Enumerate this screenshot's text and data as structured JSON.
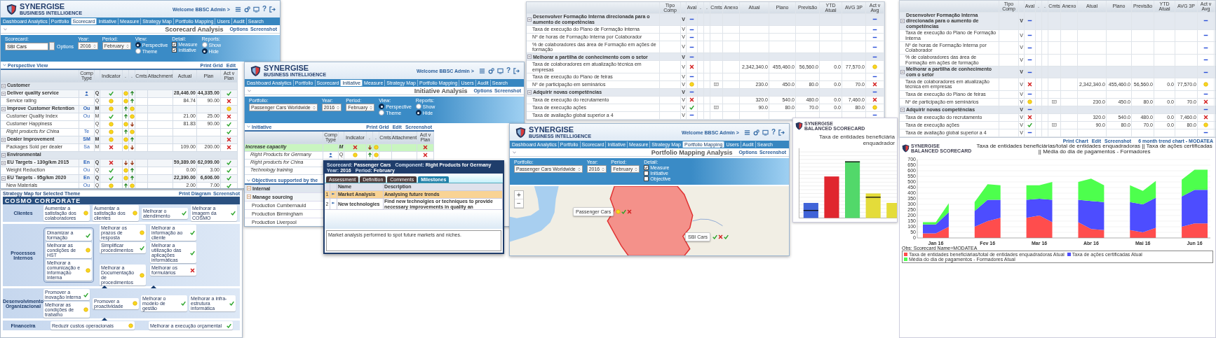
{
  "windows": [
    {
      "kind": "scorecard",
      "logo": {
        "name": "SYNERGISE",
        "tagline": "BUSINESS INTELLIGENCE"
      },
      "welcome": "Welcome BBSC Admin >",
      "help": "?",
      "nav": [
        {
          "label": "Dashboard Analytics",
          "selected": false
        },
        {
          "label": "Portfolio",
          "selected": false
        },
        {
          "label": "Scorecard",
          "selected": true
        },
        {
          "label": "Initiative",
          "selected": false
        },
        {
          "label": "Measure",
          "selected": false
        },
        {
          "label": "Strategy Map",
          "selected": false
        },
        {
          "label": "Portfolio Mapping",
          "selected": false
        },
        {
          "label": "Users",
          "selected": false
        },
        {
          "label": "Audit",
          "selected": false
        },
        {
          "label": "Search",
          "selected": false
        }
      ],
      "page_title": "Scorecard Analysis",
      "options": [
        "Options",
        "Screenshot"
      ],
      "filters": [
        {
          "kind": "field",
          "label": "Scorecard:",
          "value": "SBI Cars",
          "suffix": "Options"
        },
        {
          "kind": "select",
          "label": "Year:",
          "value": "2016"
        },
        {
          "kind": "select",
          "label": "Period:",
          "value": "February"
        },
        {
          "kind": "radio",
          "label": "View:",
          "options": [
            {
              "label": "Perspective",
              "selected": true
            },
            {
              "label": "Theme",
              "selected": false
            }
          ]
        },
        {
          "kind": "check",
          "label": "Detail:",
          "options": [
            {
              "label": "Measure",
              "checked": true
            },
            {
              "label": "Initiative",
              "checked": true
            }
          ]
        },
        {
          "kind": "radio",
          "label": "Reports:",
          "options": [
            {
              "label": "Show",
              "selected": false
            },
            {
              "label": "Hide",
              "selected": true
            }
          ]
        }
      ],
      "section": "Perspective View",
      "links": [
        "Print Grid",
        "Edit"
      ],
      "columns": [
        "Comp Type",
        "Indicator",
        ".",
        ".",
        "Cmts",
        "Attachment",
        "Actual",
        "Plan",
        "Act v Plan"
      ],
      "rows": [
        {
          "kind": "group",
          "name": "Customer",
          "expanded": true
        },
        {
          "kind": "objective",
          "name": "Deliver quality service",
          "expanded": true,
          "comp_icon": true,
          "type": "Q",
          "indicator": {
            "kind": "check"
          },
          "trend_a": {
            "kind": "dot"
          },
          "trend_b": {
            "kind": "arrow_up"
          },
          "actual": "28,446.00",
          "plan": "44,335.00",
          "vs_plan": {
            "kind": "check"
          }
        },
        {
          "kind": "measure",
          "name": "Service rating",
          "type": "Q",
          "indicator": {
            "kind": "dot"
          },
          "trend_a": {
            "kind": "dot"
          },
          "trend_b": {
            "kind": "arrow_up"
          },
          "actual": "84.74",
          "plan": "90.00",
          "vs_plan": {
            "kind": "cross"
          }
        },
        {
          "kind": "objective",
          "name": "Improve Customer Retention",
          "expanded": true,
          "comp": "Ou",
          "type": "M",
          "indicator": {
            "kind": "dot"
          },
          "trend_a": {
            "kind": "arrow_up"
          },
          "trend_b": {
            "kind": "dot"
          },
          "vs_plan": {
            "kind": "dot"
          }
        },
        {
          "kind": "measure",
          "name": "Customer Quality Index",
          "comp": "Ou",
          "type": "M",
          "indicator": {
            "kind": "check"
          },
          "trend_a": {
            "kind": "arrow_up"
          },
          "trend_b": {
            "kind": "dot"
          },
          "actual": "21.00",
          "plan": "25.00",
          "vs_plan": {
            "kind": "cross"
          }
        },
        {
          "kind": "measure",
          "name": "Customer Happiness",
          "type": "Q",
          "indicator": {
            "kind": "dot"
          },
          "trend_a": {
            "kind": "dot"
          },
          "trend_b": {
            "kind": "arrow_down"
          },
          "actual": "81.83",
          "plan": "90.00",
          "vs_plan": {
            "kind": "check"
          }
        },
        {
          "kind": "initiative",
          "name": "Right products for China",
          "comp": "Te",
          "type": "Q",
          "indicator": {
            "kind": "dot"
          },
          "trend_a": {
            "kind": "arrow_up"
          },
          "trend_b": {
            "kind": "dot"
          },
          "vs_plan": {
            "kind": "check"
          }
        },
        {
          "kind": "objective",
          "name": "Dealer Improvement",
          "expanded": true,
          "comp": "SM",
          "type": "M",
          "indicator": {
            "kind": "dot"
          },
          "trend_a": {
            "kind": "dot"
          },
          "trend_b": {
            "kind": "arrow_up"
          },
          "vs_plan": {
            "kind": "cross"
          }
        },
        {
          "kind": "measure",
          "name": "Packages Sold per dealer",
          "comp": "Sa",
          "type": "M",
          "indicator": {
            "kind": "cross"
          },
          "trend_a": {
            "kind": "dot"
          },
          "trend_b": {
            "kind": "arrow_down"
          },
          "actual": "109.00",
          "plan": "200.00",
          "vs_plan": {
            "kind": "cross"
          }
        },
        {
          "kind": "group",
          "name": "Environmental",
          "expanded": true
        },
        {
          "kind": "objective",
          "name": "EU Targets - 130g/km 2015",
          "expanded": true,
          "comp": "En",
          "type": "Q",
          "indicator": {
            "kind": "cross"
          },
          "trend_a": {
            "kind": "arrow_down"
          },
          "trend_b": {
            "kind": "arrow_down"
          },
          "actual": "59,389.00",
          "plan": "62,099.00",
          "vs_plan": {
            "kind": "check"
          }
        },
        {
          "kind": "measure",
          "name": "Weight Reduction",
          "comp": "Ou",
          "type": "Q",
          "indicator": {
            "kind": "check"
          },
          "trend_a": {
            "kind": "dot"
          },
          "trend_b": {
            "kind": "arrow_up"
          },
          "actual": "0.00",
          "plan": "3.00",
          "vs_plan": {
            "kind": "check"
          }
        },
        {
          "kind": "objective",
          "name": "EU Targets - 95g/km 2020",
          "expanded": true,
          "comp": "En",
          "type": "Q",
          "indicator": {
            "kind": "check"
          },
          "trend_a": {
            "kind": "dot"
          },
          "trend_b": {
            "kind": "arrow_up"
          },
          "actual": "22,390.00",
          "plan": "6,606.00",
          "vs_plan": {
            "kind": "check"
          }
        },
        {
          "kind": "measure",
          "name": "New Materials",
          "comp": "Ou",
          "type": "Q",
          "indicator": {
            "kind": "dot"
          },
          "trend_a": {
            "kind": "arrow_up"
          },
          "trend_b": {
            "kind": "dot"
          },
          "actual": "2.00",
          "plan": "7.00",
          "vs_plan": {
            "kind": "check"
          }
        }
      ]
    },
    {
      "kind": "initiative",
      "logo": {
        "name": "SYNERGISE",
        "tagline": "BUSINESS INTELLIGENCE"
      },
      "welcome": "Welcome BBSC Admin >",
      "help": "?",
      "nav": [
        {
          "label": "Dashboard Analytics",
          "selected": false
        },
        {
          "label": "Portfolio",
          "selected": false
        },
        {
          "label": "Scorecard",
          "selected": false
        },
        {
          "label": "Initiative",
          "selected": true
        },
        {
          "label": "Measure",
          "selected": false
        },
        {
          "label": "Strategy Map",
          "selected": false
        },
        {
          "label": "Portfolio Mapping",
          "selected": false
        },
        {
          "label": "Users",
          "selected": false
        },
        {
          "label": "Audit",
          "selected": false
        },
        {
          "label": "Search",
          "selected": false
        }
      ],
      "page_title": "Initiative Analysis",
      "options": [
        "Options",
        "Screenshot"
      ],
      "filters": [
        {
          "kind": "select",
          "label": "Portfolio:",
          "value": "Passenger Cars Worldwide"
        },
        {
          "kind": "select",
          "label": "Year:",
          "value": "2016"
        },
        {
          "kind": "select",
          "label": "Period:",
          "value": "February"
        },
        {
          "kind": "radio",
          "label": "View:",
          "options": [
            {
              "label": "Perspective",
              "selected": true
            },
            {
              "label": "Theme",
              "selected": false
            }
          ]
        },
        {
          "kind": "radio",
          "label": "Reports:",
          "options": [
            {
              "label": "Show",
              "selected": false
            },
            {
              "label": "Hide",
              "selected": true
            }
          ]
        }
      ],
      "section": "Initiative",
      "links": [
        "Print Grid",
        "Edit",
        "Screenshot"
      ],
      "columns": [
        "Comp Type",
        "Indicator",
        ".",
        ".",
        "Cmts",
        "Attachment",
        "Act v Plan"
      ],
      "rows": [
        {
          "kind": "objective",
          "name": "Increase capacity",
          "selected": true,
          "type": "M",
          "indicator": {
            "kind": "cross"
          },
          "trend_a": {
            "kind": "arrow_down"
          },
          "trend_b": {
            "kind": "dot"
          },
          "vs_plan": {
            "kind": "cross"
          }
        },
        {
          "kind": "initiative",
          "name": "Right Products for Germany",
          "selected": false,
          "comp_icon": true,
          "type": "Q",
          "indicator": {
            "kind": "dot"
          },
          "trend_a": {
            "kind": "arrow_up"
          },
          "trend_b": {
            "kind": "dot"
          },
          "vs_plan": {
            "kind": "cross"
          }
        },
        {
          "kind": "initiative",
          "name": "Right products for China",
          "selected": false
        },
        {
          "kind": "initiative",
          "name": "Technology training",
          "selected": false
        }
      ],
      "section2": "Objectives supported by the",
      "rows2": [
        {
          "kind": "group",
          "name": "Internal",
          "expanded": true
        },
        {
          "kind": "objective",
          "name": "Manage sourcing",
          "expanded": true
        },
        {
          "kind": "measure",
          "name": "Production Cumbernauld"
        },
        {
          "kind": "measure",
          "name": "Production Birmingham"
        },
        {
          "kind": "measure",
          "name": "Production Liverpool"
        }
      ]
    },
    {
      "kind": "mapping",
      "logo": {
        "name": "SYNERGISE",
        "tagline": "BUSINESS INTELLIGENCE"
      },
      "welcome": "Welcome BBSC Admin >",
      "help": "?",
      "nav": [
        {
          "label": "Dashboard Analytics",
          "selected": false
        },
        {
          "label": "Portfolio",
          "selected": false
        },
        {
          "label": "Scorecard",
          "selected": false
        },
        {
          "label": "Initiative",
          "selected": false
        },
        {
          "label": "Measure",
          "selected": false
        },
        {
          "label": "Strategy Map",
          "selected": false
        },
        {
          "label": "Portfolio Mapping",
          "selected": true
        },
        {
          "label": "Users",
          "selected": false
        },
        {
          "label": "Audit",
          "selected": false
        },
        {
          "label": "Search",
          "selected": false
        }
      ],
      "page_title": "Portfolio Mapping Analysis",
      "options": [
        "Options",
        "Screenshot"
      ],
      "filters": [
        {
          "kind": "select",
          "label": "Portfolio:",
          "value": "Passenger Cars Worldwide"
        },
        {
          "kind": "select",
          "label": "Year:",
          "value": "2016"
        },
        {
          "kind": "select",
          "label": "Period:",
          "value": "February"
        },
        {
          "kind": "check",
          "label": "Detail:",
          "options": [
            {
              "label": "Measure",
              "checked": true
            },
            {
              "label": "Initiative",
              "checked": false
            },
            {
              "label": "Objective",
              "checked": false
            }
          ]
        }
      ],
      "map": {
        "zoom": [
          "+",
          "−"
        ],
        "markers": [
          {
            "label": "Passenger Cars",
            "statuses": [
              {
                "kind": "dot"
              },
              {
                "kind": "check"
              },
              {
                "kind": "cross"
              }
            ]
          },
          {
            "label": "SBI Cars",
            "statuses": [
              {
                "kind": "check"
              },
              {
                "kind": "cross"
              },
              {
                "kind": "check"
              }
            ]
          }
        ]
      }
    }
  ],
  "popup": {
    "fields": [
      {
        "label": "Scorecard:",
        "value": "Passenger Cars"
      },
      {
        "label": "Component:",
        "value": "Right Products for Germany"
      },
      {
        "label": "Year:",
        "value": "2016"
      },
      {
        "label": "Period:",
        "value": "February"
      }
    ],
    "tabs": [
      {
        "label": "Assessment",
        "selected": false
      },
      {
        "label": "Definition",
        "selected": false
      },
      {
        "label": "Comments",
        "selected": false
      },
      {
        "label": "Milestones",
        "selected": true
      }
    ],
    "columns": [
      "Name",
      "Description"
    ],
    "rows": [
      {
        "index": "1",
        "name": "Market Analysis",
        "description": "Analysing future trends",
        "selected": true
      },
      {
        "index": "2",
        "name": "New technologies",
        "description": "Find new technolgies or techniques to provide necessary improvements in quality an",
        "selected": false
      }
    ],
    "notes": "Market analysis performed to spot future markets and niches."
  },
  "p5": {
    "table": {
      "columns": [
        "Tipo Comp",
        "Aval",
        ".",
        ".",
        "Cmts",
        "Anexo",
        "Atual",
        "Plano",
        "Previsão",
        "YTD Atual",
        "AVG 3P",
        "Act v Avg"
      ],
      "rows": [
        {
          "kind": "group",
          "name": "Desenvolver Formação Interna direcionada para o aumento de competências",
          "expanded": true,
          "type": "V",
          "aval": {
            "kind": "dash"
          },
          "act": {
            "kind": "dash"
          }
        },
        {
          "kind": "measure",
          "name": "Taxa de execução do Plano de Formação Interna",
          "type": "V",
          "aval": {
            "kind": "dash"
          },
          "act": {
            "kind": "dash"
          }
        },
        {
          "kind": "measure",
          "name": "Nº de horas de Formação Interna por Colaborador",
          "type": "V",
          "aval": {
            "kind": "dash"
          },
          "act": {
            "kind": "dash"
          }
        },
        {
          "kind": "measure",
          "name": "% de colaboradores das área de Formação em ações de formação",
          "type": "V",
          "aval": {
            "kind": "dash"
          },
          "act": {
            "kind": "dash"
          }
        },
        {
          "kind": "group",
          "name": "Melhorar a partilha de conhecimento com o setor",
          "expanded": true,
          "type": "V",
          "aval": {
            "kind": "dash"
          },
          "act": {
            "kind": "dash"
          }
        },
        {
          "kind": "measure",
          "name": "Taxa de colaboradores em atualização técnica em empresas",
          "type": "V",
          "aval": {
            "kind": "cross"
          },
          "atual": "2,342,340.0",
          "plano": "455,460.0",
          "previsao": "56,560.0",
          "ytd": "0.0",
          "avg": "77,570.0",
          "act": {
            "kind": "dot"
          }
        },
        {
          "kind": "measure",
          "name": "Taxa de execução do Plano de feiras",
          "type": "V",
          "aval": {
            "kind": "dash"
          },
          "act": {
            "kind": "dash"
          }
        },
        {
          "kind": "measure",
          "name": "Nº de participação em seminários",
          "type": "V",
          "aval": {
            "kind": "dot"
          },
          "comment": true,
          "atual": "230.0",
          "plano": "450.0",
          "previsao": "80.0",
          "ytd": "0.0",
          "avg": "70.0",
          "act": {
            "kind": "cross"
          }
        },
        {
          "kind": "group",
          "name": "Adquirir novas competências",
          "expanded": true,
          "type": "V",
          "aval": {
            "kind": "dash"
          },
          "act": {
            "kind": "dash"
          }
        },
        {
          "kind": "measure",
          "name": "Taxa de execução do recrutamento",
          "type": "V",
          "aval": {
            "kind": "cross"
          },
          "atual": "320.0",
          "plano": "540.0",
          "previsao": "480.0",
          "ytd": "0.0",
          "avg": "7,460.0",
          "act": {
            "kind": "cross"
          }
        },
        {
          "kind": "measure",
          "name": "Taxa de execução ações",
          "type": "V",
          "aval": {
            "kind": "check"
          },
          "comment": true,
          "atual": "90.0",
          "plano": "80.0",
          "previsao": "70.0",
          "ytd": "0.0",
          "avg": "80.0",
          "act": {
            "kind": "dot"
          }
        },
        {
          "kind": "measure",
          "name": "Taxa de avaliação global superior a 4",
          "type": "V",
          "aval": {
            "kind": "dash"
          },
          "act": {
            "kind": "dash"
          }
        }
      ]
    },
    "chart": {
      "logo": {
        "name": "SYNERGISE",
        "tagline": "BALANCED SCORECARD"
      },
      "title_lines": [
        "Taxa de entidades beneficiária",
        "enquadrador"
      ]
    }
  },
  "strategy": {
    "header": "Strategy Map for Selected Theme",
    "links": [
      "Print Diagram",
      "Screenshot"
    ],
    "title": "COSMO CORPORATE",
    "lanes": [
      {
        "name": "Clientes",
        "nodes": [
          {
            "label": "Aumentar a satisfação dos colaboradores",
            "status": {
              "kind": "dot"
            }
          },
          {
            "label": "Aumentar a satisfação dos clientes",
            "status": {
              "kind": "dot"
            }
          },
          {
            "label": "Melhorar o atendimento",
            "status": {
              "kind": "check"
            }
          },
          {
            "label": "Melhorar a imagem da COSMO",
            "status": {
              "kind": "check"
            }
          }
        ]
      },
      {
        "name": "Processos Internos",
        "group": [
          {
            "label": "Dinamizar a formação",
            "status": {
              "kind": "check"
            }
          },
          {
            "label": "Melhorar as condições de HST",
            "status": {
              "kind": "dot"
            }
          },
          {
            "label": "Melhorar a comunicação e informação interna",
            "status": {
              "kind": "dot"
            }
          }
        ],
        "nodes": [
          {
            "label": "Melhorar os prazos de resposta",
            "status": {
              "kind": "dot"
            }
          },
          {
            "label": "Melhorar a informação ao cliente",
            "status": {
              "kind": "check"
            }
          },
          {
            "label": "Simplificar procedimentos",
            "status": {
              "kind": "check"
            }
          },
          {
            "label": "Melhorar a utilização das aplicações informáticas",
            "status": {
              "kind": "check"
            }
          },
          {
            "label": "Melhorar a Documentação de procedimentos",
            "status": {
              "kind": "dot"
            }
          },
          {
            "label": "Melhorar os formulários",
            "status": {
              "kind": "cross"
            }
          }
        ]
      },
      {
        "name": "Desenvolvimento Organizacional",
        "stack": [
          {
            "label": "Promover a inovação interna",
            "status": {
              "kind": "check"
            }
          },
          {
            "label": "Melhorar as condições de trabalho",
            "status": {
              "kind": "dot"
            }
          }
        ],
        "nodes": [
          {
            "label": "Promover a proactividade",
            "status": {
              "kind": "dot"
            }
          },
          {
            "label": "Melhorar o modelo de gestão",
            "status": {
              "kind": "check"
            }
          },
          {
            "label": "Melhorar a infra-estrutura informática",
            "status": {
              "kind": "check"
            }
          }
        ]
      },
      {
        "name": "Financeira",
        "nodes": [
          {
            "label": "Reduzir custos operacionais",
            "status": {
              "kind": "dot"
            }
          },
          {
            "label": "Melhorar a execução orçamental",
            "status": {
              "kind": "check"
            }
          }
        ]
      }
    ]
  },
  "p7": {
    "table": {
      "columns": [
        "Tipo Comp",
        "Aval",
        ".",
        ".",
        "Cmts",
        "Anexo",
        "Atual",
        "Plano",
        "Previsão",
        "YTD Atual",
        "AVG 3P",
        "Act v Avg"
      ],
      "rows": [
        {
          "kind": "group",
          "name": "Desenvolver Formação Interna direcionada para o aumento de competências",
          "expanded": true,
          "type": "V",
          "aval": {
            "kind": "dash"
          },
          "act": {
            "kind": "dash"
          }
        },
        {
          "kind": "measure",
          "name": "Taxa de execução do Plano de Formação Interna",
          "type": "V",
          "aval": {
            "kind": "dash"
          },
          "act": {
            "kind": "dash"
          }
        },
        {
          "kind": "measure",
          "name": "Nº de horas de Formação Interna por Colaborador",
          "type": "V",
          "aval": {
            "kind": "dash"
          },
          "act": {
            "kind": "dash"
          }
        },
        {
          "kind": "measure",
          "name": "% de colaboradores das área de Formação em ações de formação",
          "type": "V",
          "aval": {
            "kind": "dash"
          },
          "act": {
            "kind": "dash"
          }
        },
        {
          "kind": "group",
          "name": "Melhorar a partilha de conhecimento com o setor",
          "expanded": true,
          "type": "V",
          "aval": {
            "kind": "dash"
          },
          "act": {
            "kind": "dash"
          }
        },
        {
          "kind": "measure",
          "name": "Taxa de colaboradores em atualização técnica em empresas",
          "type": "V",
          "aval": {
            "kind": "cross"
          },
          "atual": "2,342,340.0",
          "plano": "455,460.0",
          "previsao": "56,560.0",
          "ytd": "0.0",
          "avg": "77,570.0",
          "act": {
            "kind": "dot"
          }
        },
        {
          "kind": "measure",
          "name": "Taxa de execução do Plano de feiras",
          "type": "V",
          "aval": {
            "kind": "dash"
          },
          "act": {
            "kind": "dash"
          }
        },
        {
          "kind": "measure",
          "name": "Nº de participação em seminários",
          "type": "V",
          "aval": {
            "kind": "dot"
          },
          "comment": true,
          "atual": "230.0",
          "plano": "450.0",
          "previsao": "80.0",
          "ytd": "0.0",
          "avg": "70.0",
          "act": {
            "kind": "cross"
          }
        },
        {
          "kind": "group",
          "name": "Adquirir novas competências",
          "expanded": true,
          "type": "V",
          "aval": {
            "kind": "dash"
          },
          "act": {
            "kind": "dash"
          }
        },
        {
          "kind": "measure",
          "name": "Taxa de execução do recrutamento",
          "type": "V",
          "aval": {
            "kind": "cross"
          },
          "atual": "320.0",
          "plano": "540.0",
          "previsao": "480.0",
          "ytd": "0.0",
          "avg": "7,460.0",
          "act": {
            "kind": "cross"
          }
        },
        {
          "kind": "measure",
          "name": "Taxa de execução ações",
          "type": "V",
          "aval": {
            "kind": "check"
          },
          "comment": true,
          "atual": "90.0",
          "plano": "80.0",
          "previsao": "70.0",
          "ytd": "0.0",
          "avg": "80.0",
          "act": {
            "kind": "dot"
          }
        },
        {
          "kind": "measure",
          "name": "Taxa de avaliação global superior a 4",
          "type": "V",
          "aval": {
            "kind": "dash"
          },
          "act": {
            "kind": "dash"
          }
        }
      ]
    },
    "chart": {
      "links": [
        "Print Chart",
        "Edit",
        "Screenshot"
      ],
      "subtitle": "6 month trend chart - MODATEA",
      "logo": {
        "name": "SYNERGISE",
        "tagline": "BALANCED SCORECARD"
      },
      "note": "Obs: Scorecard Name=MODATEA",
      "chart_data": {
        "type": "area",
        "stacked": true,
        "grid": true,
        "title": "Taxa de entidades beneficiárias/total de entidades enquadradoras || Taxa de ações certificadas || Média do dia de pagamentos - Formadores",
        "categories": [
          null,
          "Jan 16",
          null,
          null,
          null,
          "Fev 16",
          null,
          null,
          null,
          "Mar 16",
          null,
          null,
          null,
          "Abr 16",
          null,
          null,
          null,
          "Mai 16",
          null,
          null,
          null,
          "Jun 16",
          null
        ],
        "ylim": [
          0,
          700
        ],
        "yticks": [
          0,
          50,
          100,
          150,
          200,
          250,
          300,
          350,
          400,
          450,
          500,
          550,
          600,
          650,
          700
        ],
        "series": [
          {
            "name": "Taxa de entidades beneficiárias/total de entidades enquadradoras Atual",
            "color": "#ff4d4d",
            "values": [
              40,
              40,
              100,
              null,
              100,
              150,
              180,
              null,
              180,
              200,
              140,
              null,
              140,
              80,
              70,
              null,
              70,
              50,
              90,
              null,
              100,
              130,
              130
            ]
          },
          {
            "name": "Taxa de ações certificadas Atual",
            "color": "#4d4dff",
            "values": [
              80,
              80,
              130,
              null,
              140,
              190,
              160,
              null,
              160,
              150,
              200,
              null,
              200,
              250,
              250,
              null,
              250,
              250,
              270,
              null,
              270,
              300,
              300
            ]
          },
          {
            "name": "Média do dia de pagamentos - Formadores Atual",
            "color": "#4dff4d",
            "values": [
              20,
              20,
              80,
              null,
              80,
              140,
              130,
              null,
              130,
              120,
              160,
              null,
              160,
              200,
              150,
              null,
              150,
              120,
              150,
              null,
              150,
              180,
              180
            ]
          }
        ]
      }
    }
  }
}
